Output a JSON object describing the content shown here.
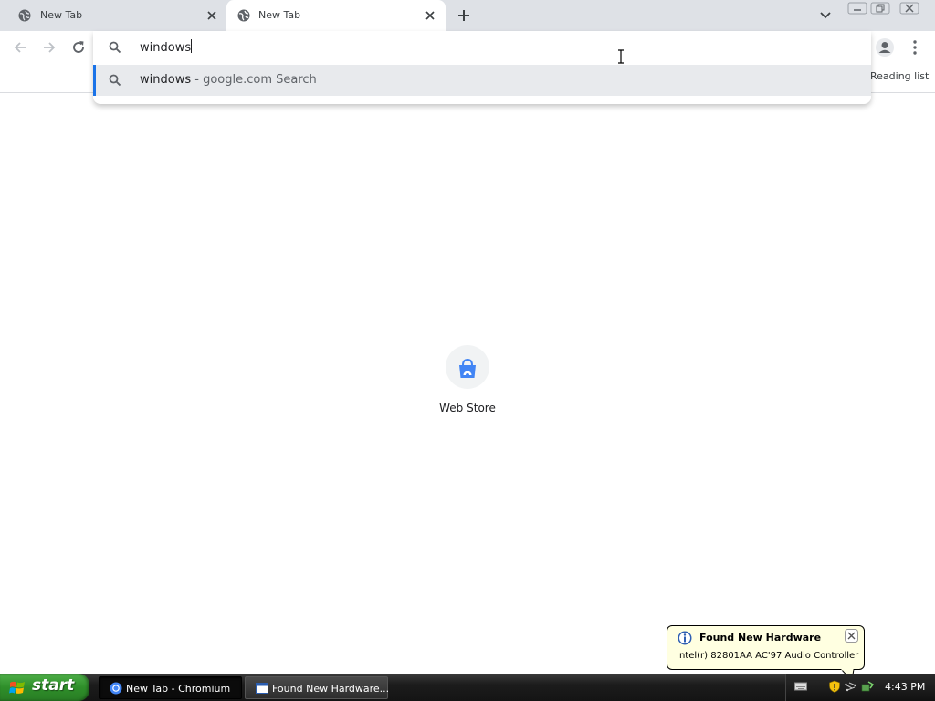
{
  "browser": {
    "tabs": [
      {
        "title": "New Tab",
        "icon": "globe-icon"
      },
      {
        "title": "New Tab",
        "icon": "globe-icon",
        "active": true
      }
    ],
    "toolbar": {
      "reading_list_label": "Reading list"
    },
    "omnibox": {
      "value": "windows",
      "suggestion": {
        "query": "windows",
        "suffix": " - google.com Search"
      }
    },
    "new_tab_page": {
      "shortcuts": [
        {
          "label": "Web Store",
          "icon": "web-store-icon"
        }
      ]
    },
    "colors": {
      "accent": "#1a73e8",
      "tab_strip": "#dee1e6"
    }
  },
  "notification": {
    "title": "Found New Hardware",
    "body": "Intel(r) 82801AA AC'97 Audio Controller"
  },
  "taskbar": {
    "start_label": "start",
    "tasks": [
      {
        "label": "New Tab - Chromium",
        "icon": "chromium-icon",
        "active": true
      },
      {
        "label": "Found New Hardware...",
        "icon": "window-icon",
        "active": false
      }
    ],
    "clock": "4:43 PM"
  }
}
